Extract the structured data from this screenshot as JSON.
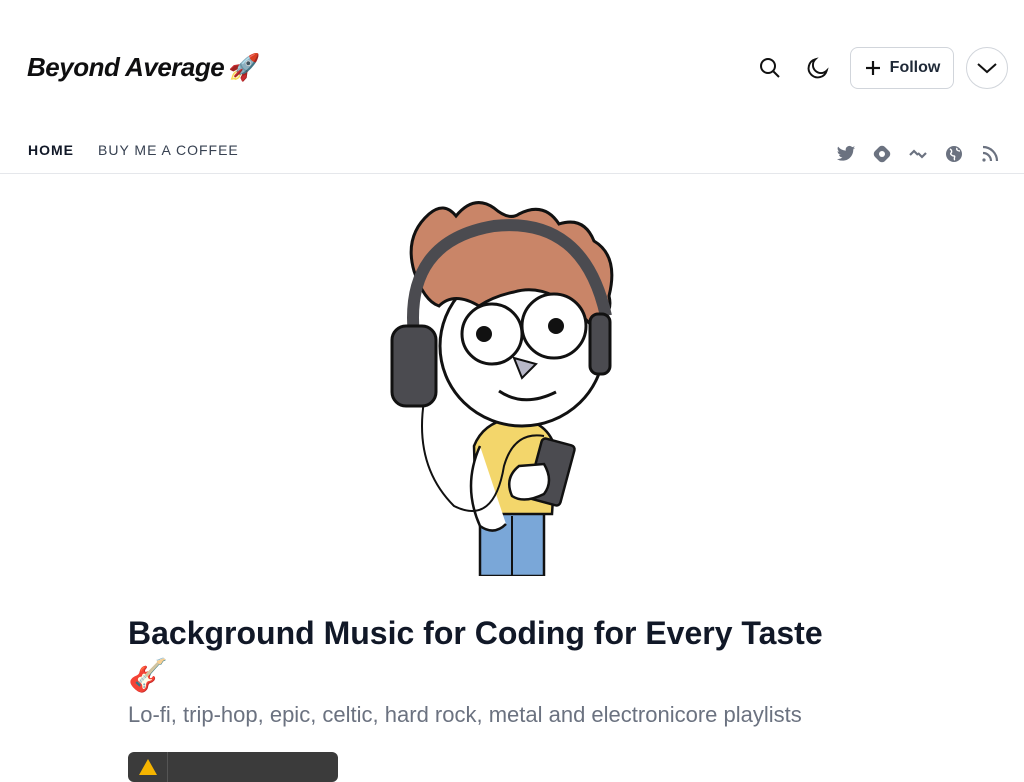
{
  "header": {
    "site_title": "Beyond Average",
    "site_emoji": "🚀",
    "follow_label": "Follow"
  },
  "icons": {
    "search": "search-icon",
    "theme": "moon-icon",
    "follow": "plus-icon",
    "menu": "chevron-down-icon"
  },
  "nav": {
    "items": [
      {
        "label": "HOME",
        "active": true
      },
      {
        "label": "BUY ME A COFFEE",
        "active": false
      }
    ],
    "social": [
      "twitter-icon",
      "hashnode-icon",
      "devto-icon",
      "website-icon",
      "rss-icon"
    ]
  },
  "article": {
    "title": "Background Music for Coding for Every Taste",
    "title_emoji": "🎸",
    "subtitle": "Lo-fi, trip-hop, epic, celtic, hard rock, metal and electronicore playlists"
  },
  "colors": {
    "text": "#111827",
    "muted": "#6b7280",
    "border": "#d1d5db",
    "hair": "#c98568",
    "shirt": "#f3d66b",
    "jeans": "#7aa7d8",
    "headphones": "#4b4b50"
  }
}
